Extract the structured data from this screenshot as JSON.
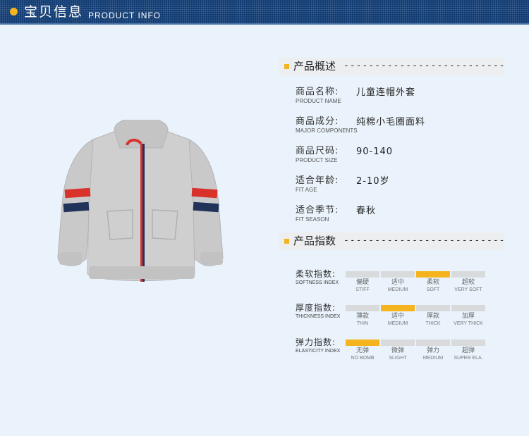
{
  "header": {
    "title": "宝贝信息",
    "subtitle": "PRODUCT INFO"
  },
  "overview": {
    "title": "产品概述",
    "dashes": "--------------------------",
    "rows": [
      {
        "label": "商品名称:",
        "sub": "PRODUCT NAME",
        "value": "儿童连帽外套"
      },
      {
        "label": "商品成分:",
        "sub": "MAJOR COMPONENTS",
        "value": "纯棉小毛圈面料"
      },
      {
        "label": "商品尺码:",
        "sub": "PRODUCT SIZE",
        "value": "90-140"
      },
      {
        "label": "适合年龄:",
        "sub": "FIT AGE",
        "value": "2-10岁"
      },
      {
        "label": "适合季节:",
        "sub": "FIT SEASON",
        "value": "春秋"
      }
    ]
  },
  "indices": {
    "title": "产品指数",
    "dashes": "--------------------------",
    "rows": [
      {
        "label": "柔软指数:",
        "sub": "SOFTNESS INDEX",
        "selected": 2,
        "levels": [
          {
            "cn": "偏硬",
            "en": "STIFF"
          },
          {
            "cn": "适中",
            "en": "MEDIUM"
          },
          {
            "cn": "柔软",
            "en": "SOFT"
          },
          {
            "cn": "超软",
            "en": "VERY SOFT"
          }
        ]
      },
      {
        "label": "厚度指数:",
        "sub": "THICKNESS INDEX",
        "selected": 1,
        "levels": [
          {
            "cn": "薄款",
            "en": "THIN"
          },
          {
            "cn": "适中",
            "en": "MEDIUM"
          },
          {
            "cn": "厚款",
            "en": "THICK"
          },
          {
            "cn": "加厚",
            "en": "VERY THICK"
          }
        ]
      },
      {
        "label": "弹力指数:",
        "sub": "ELASTICITY INDEX",
        "selected": 0,
        "levels": [
          {
            "cn": "无弹",
            "en": "NO BOMB"
          },
          {
            "cn": "微弹",
            "en": "SLIGHT"
          },
          {
            "cn": "弹力",
            "en": "MEDIUM"
          },
          {
            "cn": "超弹",
            "en": "SUPER ELA."
          }
        ]
      }
    ]
  },
  "colors": {
    "accent": "#f5b41e",
    "header_bg": "#0f3a72",
    "bar_inactive": "#d9dadb",
    "page_bg": "#eaf3fb"
  },
  "image": {
    "icon": "gray-hooded-zip-jacket-illustration"
  }
}
